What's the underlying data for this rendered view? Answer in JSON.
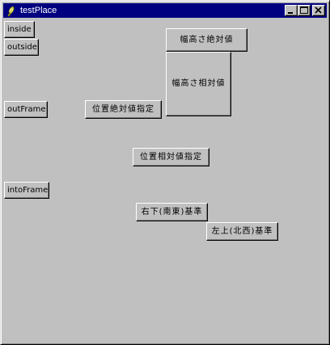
{
  "window": {
    "title": "testPlace",
    "icon": "feather-icon",
    "controls": {
      "minimize": "minimize-icon",
      "maximize": "maximize-icon",
      "close": "close-icon"
    }
  },
  "buttons": {
    "inside": "inside",
    "outside": "outside",
    "out_frame": "outFrame",
    "into_frame": "intoFrame",
    "size_absolute": "幅高さ絶対値",
    "size_relative": "幅高さ相対値",
    "position_absolute": "位置絶対値指定",
    "position_relative": "位置相対値指定",
    "anchor_bottom_right": "右下(南東)基準",
    "anchor_top_left": "左上(北西)基準"
  },
  "colors": {
    "titlebar": "#000080",
    "face": "#c0c0c0"
  }
}
